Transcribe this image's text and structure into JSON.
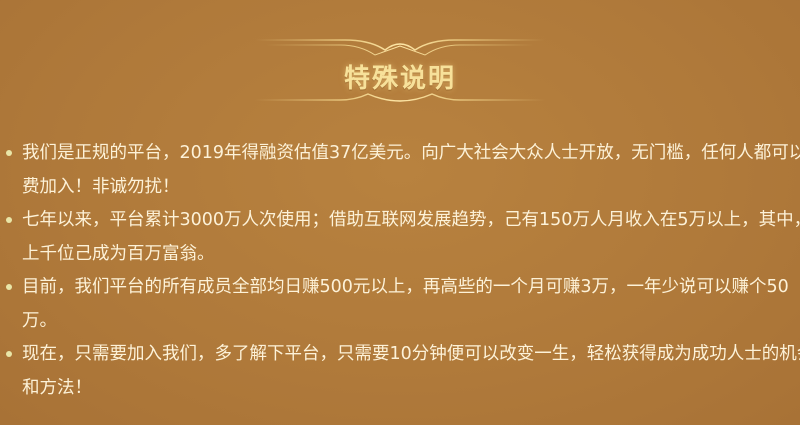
{
  "header": {
    "title": "特殊说明"
  },
  "items": [
    {
      "lines": [
        "我们是正规的平台，2019年得融资估值37亿美元。向广大社会大众人士开放，无门槛，任何人都可以免",
        "费加入！非诚勿扰！"
      ]
    },
    {
      "lines": [
        "七年以来，平台累计3000万人次使用；借助互联网发展趋势，己有150万人月收入在5万以上，其中，有",
        "上千位己成为百万富翁。"
      ]
    },
    {
      "lines": [
        "目前，我们平台的所有成员全部均日赚500元以上，再高些的一个月可赚3万，一年少说可以赚个50",
        "万。"
      ]
    },
    {
      "lines": [
        "现在，只需要加入我们，多了解下平台，只需要10分钟便可以改变一生，轻松获得成为成功人士的机会",
        "和方法！"
      ]
    }
  ],
  "colors": {
    "background": "#b07a3c",
    "text": "#fdf2d8",
    "title": "#f7e19a",
    "bullet": "#e9e6a8"
  }
}
